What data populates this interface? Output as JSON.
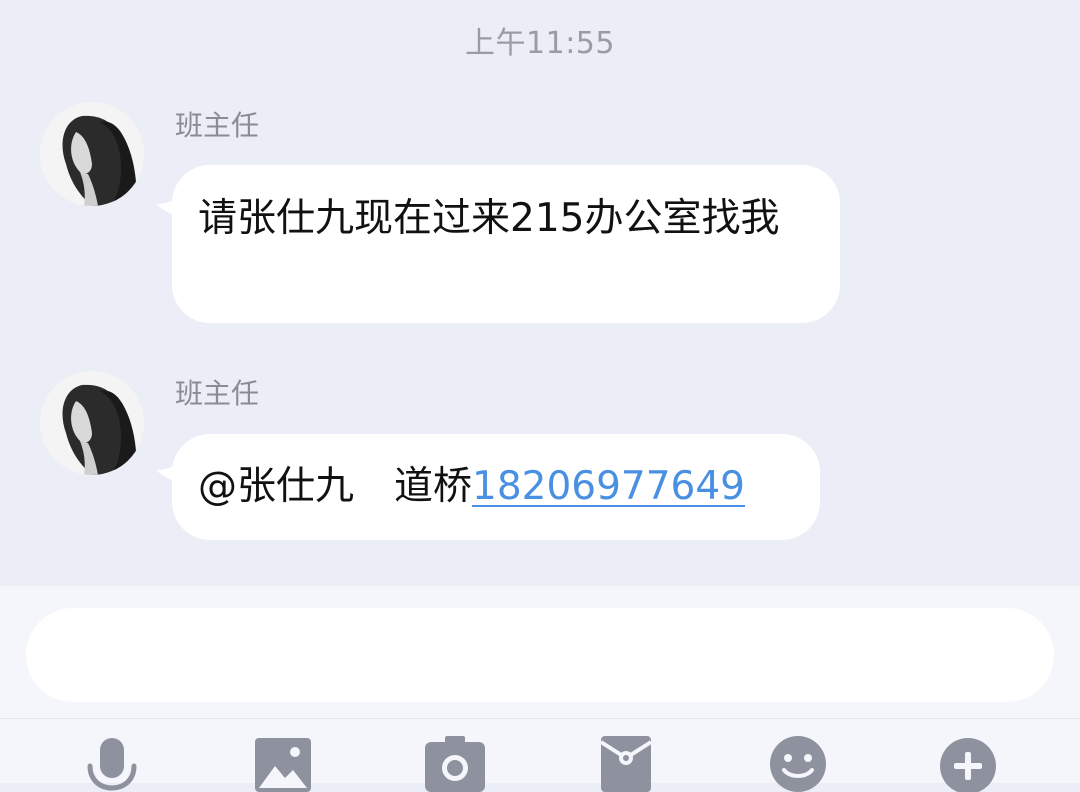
{
  "timestamp": "上午11:55",
  "messages": [
    {
      "sender": "班主任",
      "text": "请张仕九现在过来215办公室找我"
    },
    {
      "sender": "班主任",
      "mention": "@张仕九",
      "text": "道桥",
      "phone": "18206977649"
    }
  ],
  "input": {
    "value": "",
    "placeholder": ""
  },
  "toolbar": {
    "icons": [
      "microphone-icon",
      "image-icon",
      "camera-icon",
      "red-packet-icon",
      "emoji-icon",
      "plus-icon"
    ],
    "icon_color": "#8e929f"
  },
  "colors": {
    "chat_background": "#ebeef7",
    "bubble": "#ffffff",
    "link": "#4a90e2"
  }
}
